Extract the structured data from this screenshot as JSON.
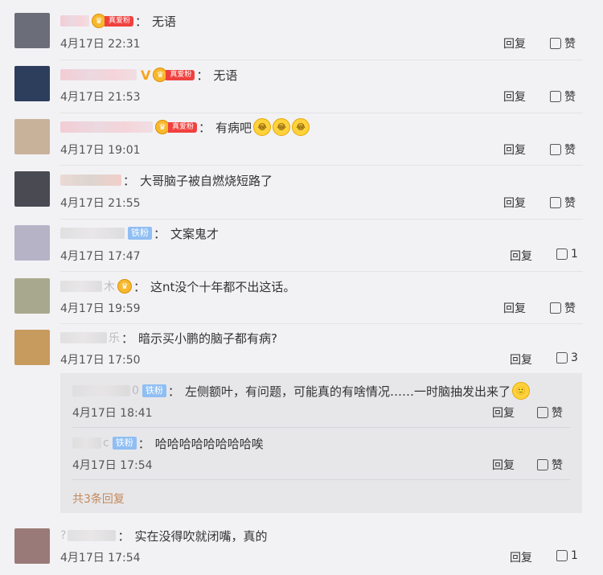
{
  "comments": [
    {
      "id": "c1",
      "badge": "真爱粉",
      "text": "无语",
      "time": "4月17日 22:31",
      "reply": "回复",
      "like": "赞"
    },
    {
      "id": "c2",
      "badge": "真爱粉",
      "verified": "V",
      "text": "无语",
      "time": "4月17日 21:53",
      "reply": "回复",
      "like": "赞"
    },
    {
      "id": "c3",
      "badge": "真爱粉",
      "text": "有病吧",
      "time": "4月17日 19:01",
      "reply": "回复",
      "like": "赞"
    },
    {
      "id": "c4",
      "text": "大哥脑子被自燃烧短路了",
      "time": "4月17日 21:55",
      "reply": "回复",
      "like": "赞"
    },
    {
      "id": "c5",
      "fan": "铁粉",
      "text": "文案鬼才",
      "time": "4月17日 17:47",
      "reply": "回复",
      "like": "1"
    },
    {
      "id": "c6",
      "text": "这nt没个十年都不出这话。",
      "time": "4月17日 19:59",
      "reply": "回复",
      "like": "赞"
    },
    {
      "id": "c7",
      "text": "暗示买小鹏的脑子都有病?",
      "time": "4月17日 17:50",
      "reply": "回复",
      "like": "3"
    },
    {
      "id": "c8",
      "text": "实在没得吹就闭嘴，真的",
      "time": "4月17日 17:54",
      "reply": "回复",
      "like": "1"
    }
  ],
  "replies": [
    {
      "id": "r1",
      "fan": "铁粉",
      "text": "左侧额叶，有问题，可能真的有啥情况……一时脑抽发出来了",
      "time": "4月17日 18:41",
      "reply": "回复",
      "like": "赞"
    },
    {
      "id": "r2",
      "fan": "铁粉",
      "text": "哈哈哈哈哈哈哈哈唉",
      "time": "4月17日 17:54",
      "reply": "回复",
      "like": "赞"
    }
  ],
  "replies_total": "共3条回复",
  "colon": "：",
  "name_fragments": {
    "c6": "木",
    "c7": "乐",
    "c8": "?",
    "r1": "0",
    "r2": "c"
  },
  "colors": {
    "background": "#f2f2f5",
    "accent_link": "#c4885a",
    "badge_red": "#f0413e",
    "fan_blue": "#8fbef3"
  }
}
